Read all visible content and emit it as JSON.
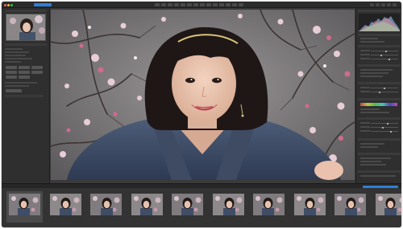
{
  "window": {
    "tabs": [
      "",
      ""
    ],
    "active_tab_index": 1
  },
  "colors": {
    "accent": "#2f7fd6",
    "chrome_dark": "#2b2b2b",
    "panel": "#2f2f2f",
    "filmstrip": "#333333"
  },
  "filmstrip": {
    "count_label": "",
    "items": [
      {
        "caption": ""
      },
      {
        "caption": ""
      },
      {
        "caption": ""
      },
      {
        "caption": ""
      },
      {
        "caption": ""
      },
      {
        "caption": ""
      },
      {
        "caption": ""
      },
      {
        "caption": ""
      },
      {
        "caption": ""
      },
      {
        "caption": ""
      }
    ],
    "selected_index": 0
  },
  "icons": {
    "window_controls": [
      "close-dot",
      "minimize-dot",
      "zoom-dot"
    ]
  }
}
